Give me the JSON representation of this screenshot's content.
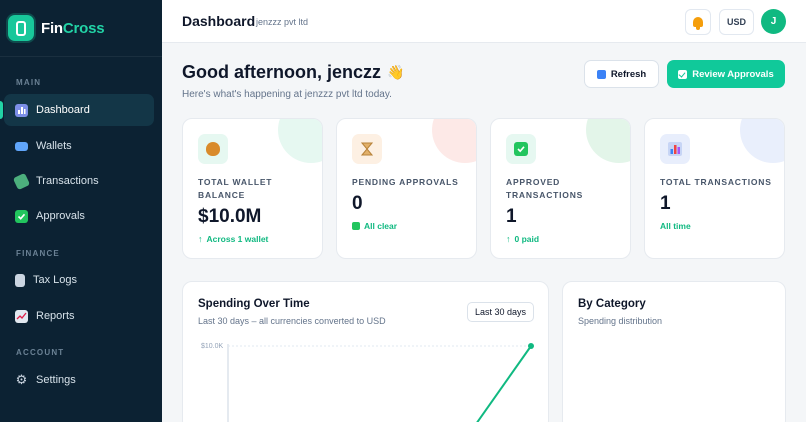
{
  "brand": {
    "name_part1": "Fin",
    "name_part2": "Cross",
    "accent": "#22d3a6"
  },
  "sidebar": {
    "sections": [
      {
        "label": "MAIN"
      },
      {
        "label": "FINANCE"
      },
      {
        "label": "ACCOUNT"
      }
    ],
    "items": [
      {
        "label": "Dashboard",
        "icon": "bar-chart-icon",
        "active": true
      },
      {
        "label": "Wallets",
        "icon": "credit-card-icon"
      },
      {
        "label": "Transactions",
        "icon": "money-wings-icon"
      },
      {
        "label": "Approvals",
        "icon": "check-box-icon"
      },
      {
        "label": "Tax Logs",
        "icon": "ledger-icon"
      },
      {
        "label": "Reports",
        "icon": "line-chart-icon"
      },
      {
        "label": "Settings",
        "icon": "gear-icon"
      }
    ]
  },
  "header": {
    "title": "Dashboard",
    "company": "jenzzz pvt ltd",
    "currency": "USD",
    "avatar_initial": "J"
  },
  "greeting": {
    "title": "Good afternoon, jenczz",
    "emoji": "👋",
    "subtitle": "Here's what's happening at jenzzz pvt ltd today."
  },
  "actions": {
    "refresh": "Refresh",
    "review": "Review Approvals"
  },
  "stats": [
    {
      "label": "TOTAL WALLET BALANCE",
      "value": "$10.0M",
      "note": "Across 1 wallet",
      "note_icon": "arrow-up-icon",
      "icon": "money-bag-icon",
      "tint": "#e6f8f1",
      "blob": "#e6f8f1"
    },
    {
      "label": "PENDING APPROVALS",
      "value": "0",
      "note": "All clear",
      "note_icon": "check-box-icon",
      "icon": "hourglass-icon",
      "tint": "#fdf0e3",
      "blob": "#fde9e7"
    },
    {
      "label": "APPROVED TRANSACTIONS",
      "value": "1",
      "note": "0 paid",
      "note_icon": "arrow-up-icon",
      "icon": "check-box-icon",
      "tint": "#e6f8f1",
      "blob": "#e3f5e9"
    },
    {
      "label": "TOTAL TRANSACTIONS",
      "value": "1",
      "note": "All time",
      "note_icon": "",
      "icon": "bar-chart-icon",
      "tint": "#e8eefc",
      "blob": "#e9effc"
    }
  ],
  "spending": {
    "title": "Spending Over Time",
    "subtitle": "Last 30 days – all currencies converted to USD",
    "range_label": "Last 30 days",
    "chart_data": {
      "type": "line",
      "title": "Spending Over Time",
      "ytick_labels": [
        "$10.0K"
      ],
      "ylim": [
        0,
        10000
      ],
      "series": [
        {
          "values": [
            0,
            10000
          ]
        }
      ],
      "x": [
        0,
        1
      ],
      "grid": true,
      "color": "#10b981"
    }
  },
  "category": {
    "title": "By Category",
    "subtitle": "Spending distribution"
  }
}
